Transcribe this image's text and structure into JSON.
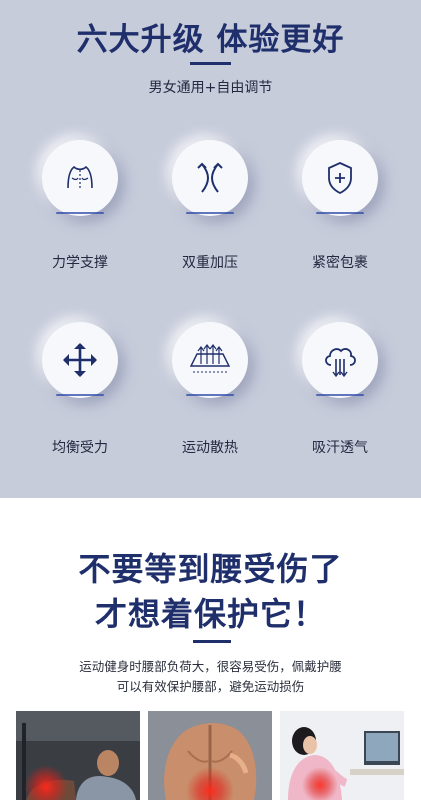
{
  "upgrade": {
    "title": "六大升级 体验更好",
    "subtitle": "男女通用+自由调节",
    "features": [
      {
        "label": "力学支撑",
        "icon": "back-support-icon"
      },
      {
        "label": "双重加压",
        "icon": "double-pressure-icon"
      },
      {
        "label": "紧密包裹",
        "icon": "shield-plus-icon"
      },
      {
        "label": "均衡受力",
        "icon": "four-arrows-icon"
      },
      {
        "label": "运动散热",
        "icon": "heat-dissipation-icon"
      },
      {
        "label": "吸汗透气",
        "icon": "breathable-cloud-icon"
      }
    ]
  },
  "warning": {
    "headline_line1": "不要等到腰受伤了",
    "headline_line2": "才想着保护它！",
    "desc_line1": "运动健身时腰部负荷大，很容易受伤，佩戴护腰",
    "desc_line2": "可以有效保护腰部，避免运动损伤"
  },
  "photos": [
    {
      "name": "athlete-back-pain-photo"
    },
    {
      "name": "bare-back-pain-photo"
    },
    {
      "name": "office-worker-back-pain-photo"
    }
  ],
  "colors": {
    "accent": "#1f2f6b",
    "panel": "#c7ccdb",
    "pain": "#e0221c"
  }
}
